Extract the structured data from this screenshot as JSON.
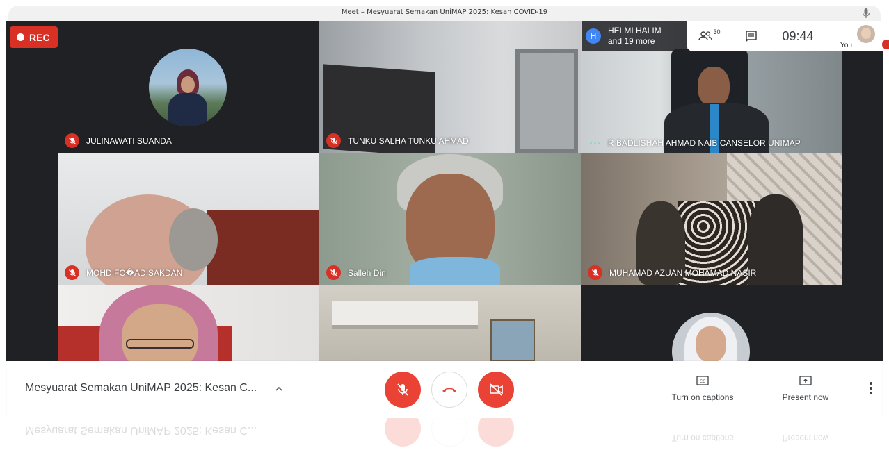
{
  "window": {
    "title": "Meet – Mesyuarat Semakan UniMAP 2025: Kesan COVID-19"
  },
  "recording": {
    "label": "REC"
  },
  "top_overlay": {
    "avatar_letter": "H",
    "name": "HELMI HALIM",
    "more": "and 19 more"
  },
  "topbar": {
    "participant_count": "30",
    "time": "09:44",
    "you_label": "You"
  },
  "tiles": [
    {
      "name": "JULINAWATI SUANDA",
      "muted": true
    },
    {
      "name": "TUNKU SALHA TUNKU AHMAD",
      "muted": true
    },
    {
      "name": "R BADLISHAH AHMAD NAIB CANSELOR UNIMAP",
      "muted": false,
      "speaking": true
    },
    {
      "name": "MOHD FO�AD SAKDAN",
      "muted": true
    },
    {
      "name": "Salleh Din",
      "muted": true
    },
    {
      "name": "MUHAMAD AZUAN MOHAMAD NASIR",
      "muted": true
    }
  ],
  "bottom": {
    "meeting_name": "Mesyuarat Semakan UniMAP 2025: Kesan C...",
    "captions_label": "Turn on captions",
    "present_label": "Present now"
  },
  "icons": [
    "mic-icon",
    "people-icon",
    "chat-icon",
    "mic-off-icon",
    "end-call-icon",
    "camera-off-icon",
    "captions-icon",
    "present-icon",
    "more-icon",
    "chevron-up-icon"
  ],
  "colors": {
    "red": "#ea4335",
    "rec_red": "#d93025",
    "dark": "#202124",
    "accent_blue": "#4285f4"
  }
}
